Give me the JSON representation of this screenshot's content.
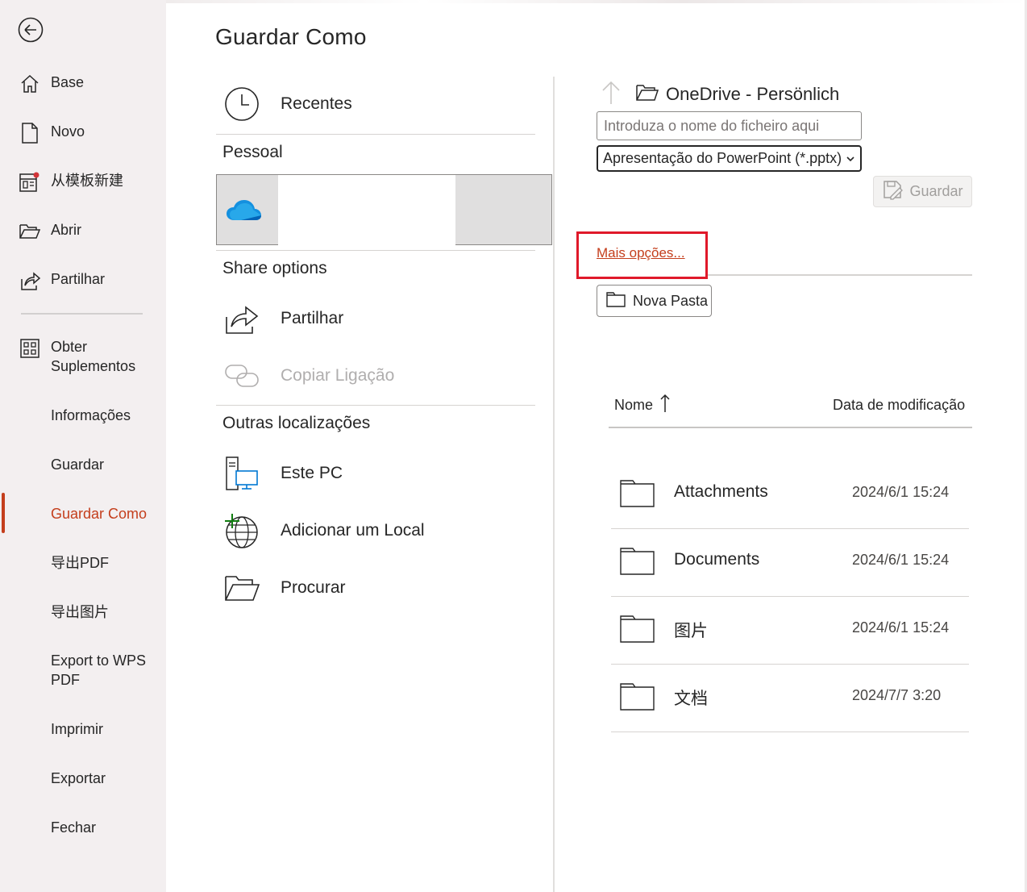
{
  "sidebar": {
    "items": [
      {
        "label": "Base",
        "icon": "home-icon"
      },
      {
        "label": "Novo",
        "icon": "new-document-icon"
      },
      {
        "label": "从模板新建",
        "icon": "template-icon"
      },
      {
        "label": "Abrir",
        "icon": "open-folder-icon"
      },
      {
        "label": "Partilhar",
        "icon": "share-icon"
      },
      {
        "label": "Obter\nSuplementos",
        "icon": "addins-icon"
      },
      {
        "label": "Informações"
      },
      {
        "label": "Guardar"
      },
      {
        "label": "Guardar Como",
        "active": true
      },
      {
        "label": "导出PDF"
      },
      {
        "label": "导出图片"
      },
      {
        "label": "Export to WPS PDF"
      },
      {
        "label": "Imprimir"
      },
      {
        "label": "Exportar"
      },
      {
        "label": "Fechar"
      }
    ]
  },
  "page_title": "Guardar Como",
  "locations": {
    "recent_label": "Recentes",
    "personal_heading": "Pessoal",
    "share_heading": "Share options",
    "share_label": "Partilhar",
    "copy_link_label": "Copiar Ligação",
    "other_heading": "Outras localizações",
    "this_pc_label": "Este PC",
    "add_place_label": "Adicionar um Local",
    "browse_label": "Procurar"
  },
  "save_panel": {
    "path": "OneDrive - Persönlich",
    "filename_placeholder": "Introduza o nome do ficheiro aqui",
    "file_type": "Apresentação do PowerPoint (*.pptx)",
    "save_label": "Guardar",
    "more_options": "Mais opções...",
    "new_folder": "Nova Pasta",
    "col_name": "Nome",
    "col_date": "Data de modificação",
    "files": [
      {
        "name": "Attachments",
        "date": "2024/6/1 15:24"
      },
      {
        "name": "Documents",
        "date": "2024/6/1 15:24"
      },
      {
        "name": "图片",
        "date": "2024/6/1 15:24"
      },
      {
        "name": "文档",
        "date": "2024/7/7 3:20"
      }
    ]
  },
  "colors": {
    "accent": "#c43e1c",
    "highlight_box": "#e0192a",
    "sidebar_bg": "#f3eff0"
  }
}
